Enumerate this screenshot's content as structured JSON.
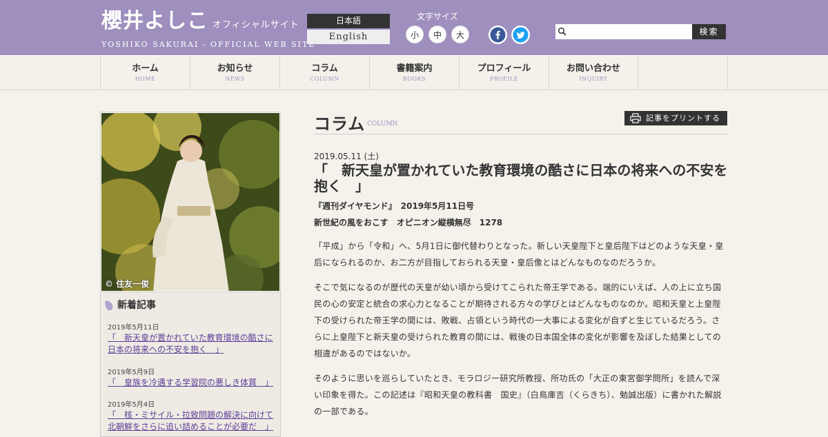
{
  "header": {
    "logo_jp": "櫻井よしこ",
    "logo_sub": "オフィシャルサイト",
    "logo_en": "YOSHIKO SAKURAI - OFFICIAL WEB SITE",
    "lang_ja": "日本語",
    "lang_en": "English",
    "font_size_label": "文字サイズ",
    "font_small": "小",
    "font_medium": "中",
    "font_large": "大",
    "search_placeholder": "",
    "search_button": "検索"
  },
  "nav": [
    {
      "jp": "ホーム",
      "en": "HOME"
    },
    {
      "jp": "お知らせ",
      "en": "NEWS"
    },
    {
      "jp": "コラム",
      "en": "COLUMN"
    },
    {
      "jp": "書籍案内",
      "en": "BOOKS"
    },
    {
      "jp": "プロフィール",
      "en": "PROFILE"
    },
    {
      "jp": "お問い合わせ",
      "en": "INQUIRY"
    }
  ],
  "sidebar": {
    "photo_credit": "© 住友一俊",
    "news_heading": "新着記事",
    "news": [
      {
        "date": "2019年5月11日",
        "title": "「　新天皇が置かれていた教育環境の酷さに日本の将来への不安を抱く　」"
      },
      {
        "date": "2019年5月9日",
        "title": "「　皇族を冷遇する学習院の悪しき体質　」"
      },
      {
        "date": "2019年5月4日",
        "title": "「　核・ミサイル・拉致問題の解決に向けて北朝鮮をさらに追い詰めることが必要だ　」"
      }
    ]
  },
  "main": {
    "section_title": "コラム",
    "section_title_en": "COLUMN",
    "print_button": "記事をプリントする",
    "article": {
      "date": "2019.05.11 (土)",
      "title": "「　新天皇が置かれていた教育環境の酷さに日本の将来への不安を抱く　」",
      "source1": "『週刊ダイヤモンド』　2019年5月11日号",
      "source2": "新世紀の風をおこす　オピニオン縦横無尽　1278",
      "paragraphs": [
        "「平成」から「令和」へ、5月1日に御代替わりとなった。新しい天皇陛下と皇后陛下はどのような天皇・皇后になられるのか、お二方が目指しておられる天皇・皇后像とはどんなものなのだろうか。",
        "そこで気になるのが歴代の天皇が幼い頃から受けてこられた帝王学である。端的にいえば、人の上に立ち国民の心の安定と統合の求心力となることが期待される方々の学びとはどんなものなのか。昭和天皇と上皇陛下の受けられた帝王学の間には、敗戦、占領という時代の一大事による変化が自ずと生じているだろう。さらに上皇陛下と新天皇の受けられた教育の間には、戦後の日本国全体の変化が影響を及ぼした結果としての相違があるのではないか。",
        "そのように思いを巡らしていたとき、モラロジー研究所教授、所功氏の「大正の東宮御学問所」を読んで深い印象を得た。この記述は『昭和天皇の教科書　国史』（白鳥庫吉（くらきち）、勉誠出版）に書かれた解説の一部である。"
      ]
    }
  },
  "colors": {
    "header_bg": "#9e8fbe",
    "link": "#5a3f99",
    "facebook": "#3b5998",
    "twitter": "#1da1f2"
  }
}
